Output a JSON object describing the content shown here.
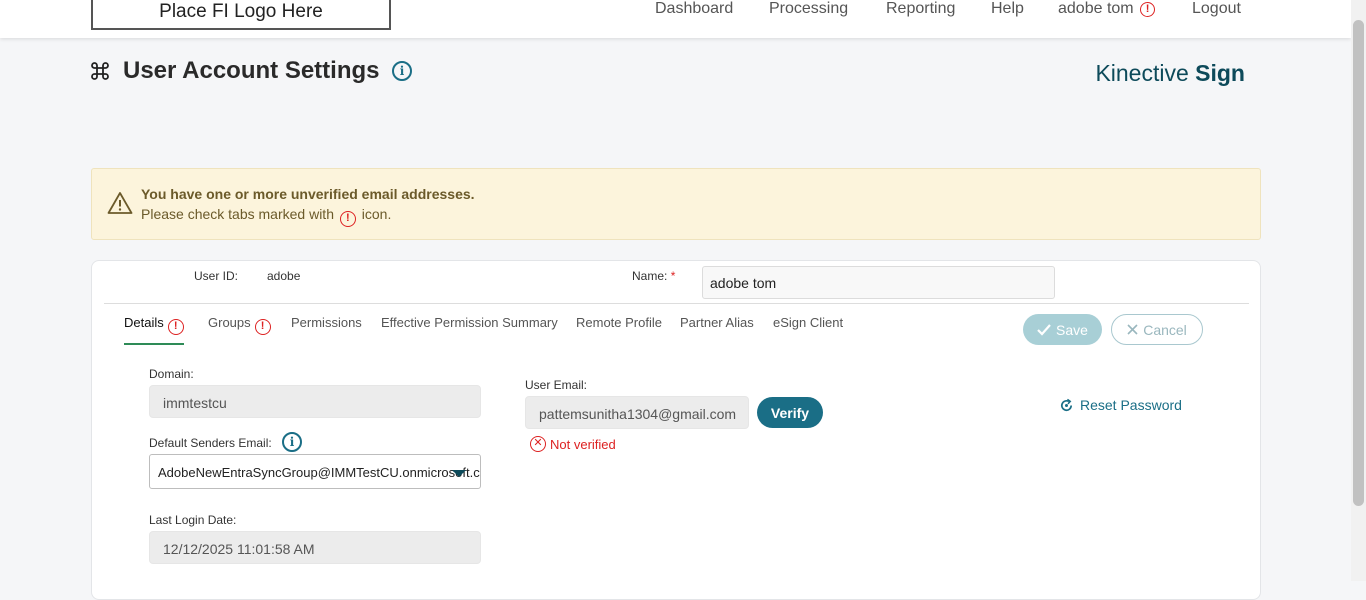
{
  "header": {
    "logo_text": "Place FI Logo Here",
    "nav": {
      "dashboard": "Dashboard",
      "processing": "Processing",
      "reporting": "Reporting",
      "help": "Help",
      "user": "adobe tom",
      "logout": "Logout"
    },
    "warning_glyph": "!"
  },
  "page": {
    "title": "User Account Settings",
    "title_icon": "command-icon",
    "info_glyph": "i",
    "brand_light": "Kinective",
    "brand_bold": "Sign"
  },
  "alert": {
    "title": "You have one or more unverified email addresses.",
    "body_prefix": "Please check tabs marked with",
    "body_suffix": "icon."
  },
  "user": {
    "id_label": "User ID:",
    "id_value": "adobe",
    "name_label": "Name:",
    "name_required": "*",
    "name_value": "adobe tom"
  },
  "tabs": [
    {
      "label": "Details"
    },
    {
      "label": "Groups"
    },
    {
      "label": "Permissions"
    },
    {
      "label": "Effective Permission Summary"
    },
    {
      "label": "Remote Profile"
    },
    {
      "label": "Partner Alias"
    },
    {
      "label": "eSign Client"
    }
  ],
  "actions": {
    "save": "Save",
    "cancel": "Cancel"
  },
  "details": {
    "domain_label": "Domain:",
    "domain_value": "immtestcu",
    "senders_label": "Default Senders Email:",
    "senders_value": "AdobeNewEntraSyncGroup@IMMTestCU.onmicrosoft.com",
    "last_login_label": "Last Login Date:",
    "last_login_value": "12/12/2025 11:01:58 AM",
    "email_label": "User Email:",
    "email_value": "pattemsunitha1304@gmail.com",
    "verify": "Verify",
    "not_verified": "Not verified",
    "reset_password": "Reset Password"
  },
  "colors": {
    "accent": "#1a6e86",
    "warning": "#dd2222",
    "alert_bg": "#fcf4dc",
    "active_tab": "#2e8b57"
  }
}
